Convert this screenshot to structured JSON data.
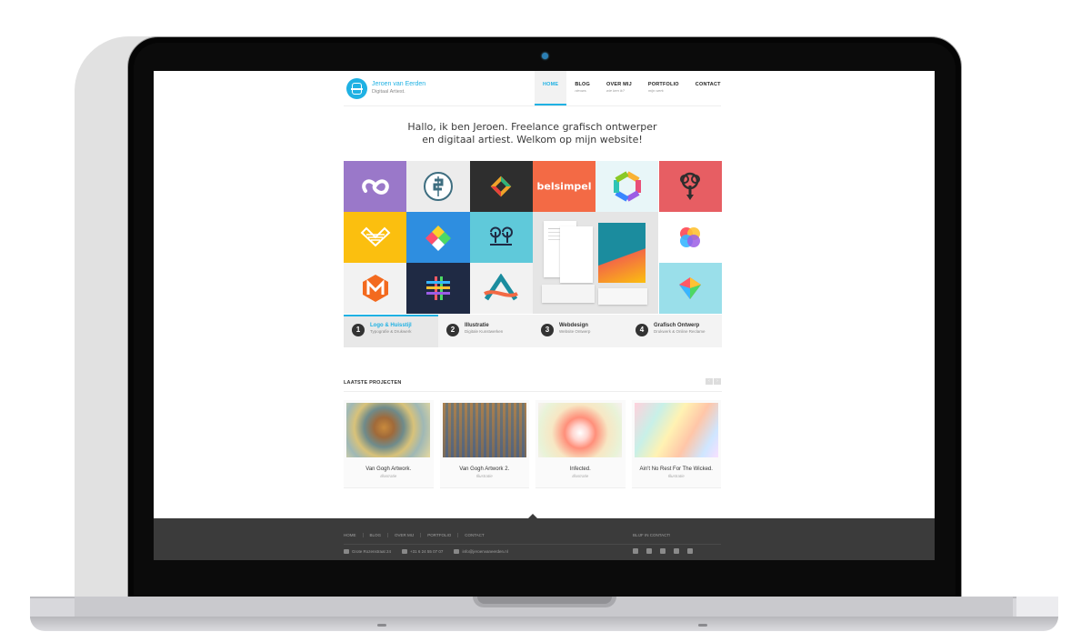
{
  "site": {
    "name": "Jeroen van Eerden",
    "tagline": "Digitaal Artiest."
  },
  "nav": [
    {
      "label": "HOME",
      "sub": "",
      "active": true
    },
    {
      "label": "BLOG",
      "sub": "nieuws"
    },
    {
      "label": "OVER MIJ",
      "sub": "wie ben ik?"
    },
    {
      "label": "PORTFOLIO",
      "sub": "mijn werk"
    },
    {
      "label": "CONTACT",
      "sub": ""
    }
  ],
  "intro": {
    "line1": "Hallo, ik ben Jeroen. Freelance grafisch ontwerper",
    "line2": "en digitaal artiest. Welkom op mijn website!"
  },
  "grid": {
    "belsimpel_label": "belsimpel",
    "colors": {
      "purple": "#9a78c9",
      "dark": "#2e2e2e",
      "orange": "#f36a45",
      "red": "#e75e63",
      "yellow": "#fbbf0f",
      "blue": "#2e8ee0",
      "cyan": "#5fc9da",
      "navy": "#1f2a44",
      "light": "#e8f6f8",
      "teal": "#1b8c9e"
    }
  },
  "tabs": [
    {
      "num": "1",
      "title": "Logo & Huisstijl",
      "sub": "Typografie & Drukwerk",
      "active": true
    },
    {
      "num": "2",
      "title": "Illustratie",
      "sub": "Digitale Kunstwerken"
    },
    {
      "num": "3",
      "title": "Webdesign",
      "sub": "Website Ontwerp"
    },
    {
      "num": "4",
      "title": "Grafisch Ontwerp",
      "sub": "Drukwerk & Online Reclame"
    }
  ],
  "latest": {
    "title": "LAATSTE PROJECTEN",
    "projects": [
      {
        "title": "Van Gogh Artwork.",
        "category": "Illustratie"
      },
      {
        "title": "Van Gogh Artwork 2.",
        "category": "Illustratie"
      },
      {
        "title": "Infected.",
        "category": "Illustratie"
      },
      {
        "title": "Ain't No Rest For The Wicked.",
        "category": "Illustratie"
      }
    ]
  },
  "footer": {
    "nav": [
      "HOME",
      "BLOG",
      "OVER MIJ",
      "PORTFOLIO",
      "CONTACT"
    ],
    "address": "Grote Rozenstraat 24",
    "phone": "+31 6 24 55 07 07",
    "email": "info@jeroenvaneerden.nl",
    "social_title": "BLIJF IN CONTACT!"
  },
  "accent": "#1fb1e3"
}
